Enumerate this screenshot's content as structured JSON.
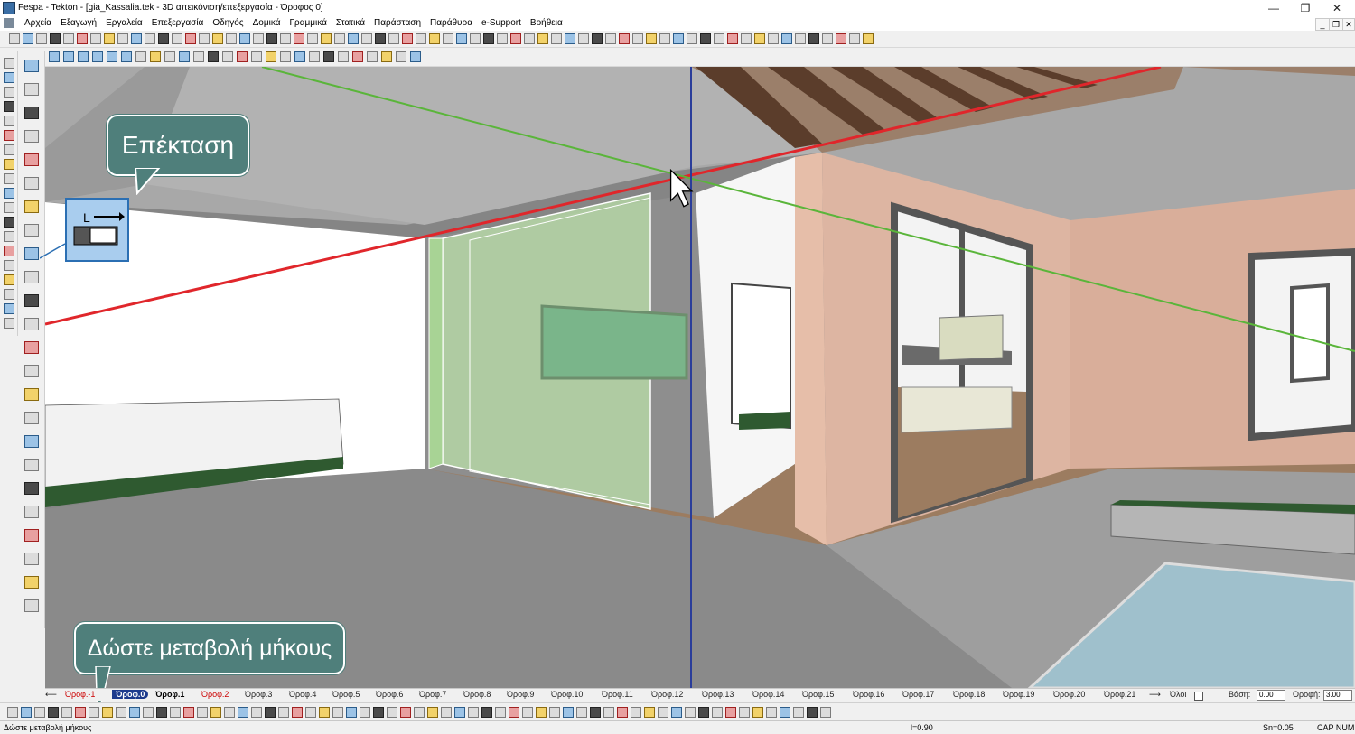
{
  "window": {
    "title": "Fespa - Tekton - [gia_Kassalia.tek - 3D απεικόνιση/επεξεργασία - Όροφος 0]",
    "min": "—",
    "max": "❐",
    "close": "✕"
  },
  "menu": [
    "Αρχεία",
    "Εξαγωγή",
    "Εργαλεία",
    "Επεξεργασία",
    "Οδηγός",
    "Δομικά",
    "Γραμμικά",
    "Στατικά",
    "Παράσταση",
    "Παράθυρα",
    "e-Support",
    "Βοήθεια"
  ],
  "mdi": {
    "min": "_",
    "restore": "❐",
    "close": "✕"
  },
  "callouts": {
    "extend": "Επέκταση",
    "prompt": "Δώστε μεταβολή μήκους"
  },
  "floors": {
    "tabs": [
      "Όροφ.-1",
      "Όροφ.0",
      "Όροφ.1",
      "Όροφ.2",
      "Όροφ.3",
      "Όροφ.4",
      "Όροφ.5",
      "Όροφ.6",
      "Όροφ.7",
      "Όροφ.8",
      "Όροφ.9",
      "Όροφ.10",
      "Όροφ.11",
      "Όροφ.12",
      "Όροφ.13",
      "Όροφ.14",
      "Όροφ.15",
      "Όροφ.16",
      "Όροφ.17",
      "Όροφ.18",
      "Όροφ.19",
      "Όροφ.20",
      "Όροφ.21"
    ],
    "all_label": "Όλοι",
    "base_label": "Βάση:",
    "base_value": "0.00",
    "ceiling_label": "Οροφή:",
    "ceiling_value": "3.00"
  },
  "status": {
    "prompt": "Δώστε μεταβολή μήκους",
    "length": "l=0.90",
    "snap": "Sn=0.05",
    "caps": "CAP NUM"
  },
  "colors": {
    "callout_bg": "#4f7f7b",
    "red_axis": "#e0262b",
    "green_axis": "#5ab53a",
    "blue_axis": "#2a3d9a",
    "active_floor": "#1c3a8c"
  }
}
